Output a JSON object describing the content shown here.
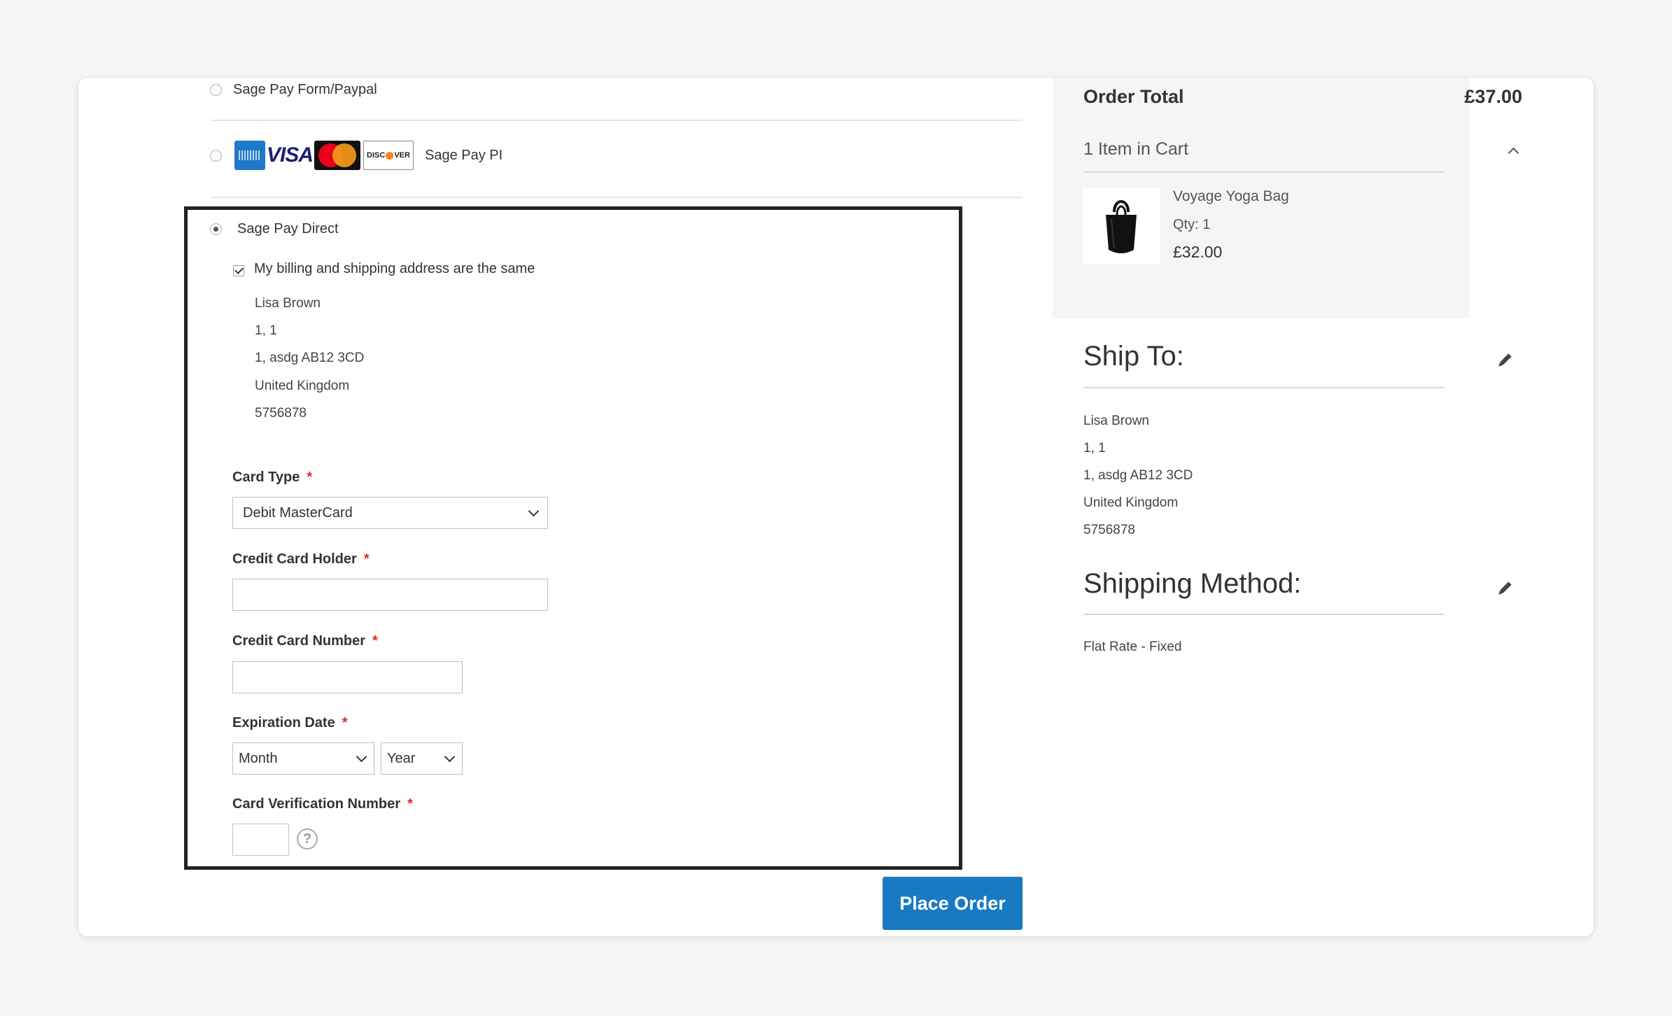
{
  "payment_methods": {
    "form_paypal": {
      "label": "Sage Pay Form/Paypal"
    },
    "pi": {
      "label": "Sage Pay PI",
      "card_logos": [
        "amex-icon",
        "visa-icon",
        "mastercard-icon",
        "discover-icon"
      ],
      "visa_text": "VISA",
      "discover_text": "DISC VER"
    },
    "direct": {
      "label": "Sage Pay Direct",
      "same_address_label": "My billing and shipping address are the same",
      "address": {
        "name": "Lisa Brown",
        "line1": "1, 1",
        "line2": "1, asdg AB12 3CD",
        "country": "United Kingdom",
        "phone": "5756878"
      },
      "fields": {
        "card_type": {
          "label": "Card Type",
          "value": "Debit MasterCard"
        },
        "holder": {
          "label": "Credit Card Holder",
          "value": ""
        },
        "number": {
          "label": "Credit Card Number",
          "value": ""
        },
        "expiration": {
          "label": "Expiration Date",
          "month": "Month",
          "year": "Year"
        },
        "cvv": {
          "label": "Card Verification Number",
          "value": "",
          "help": "?"
        }
      },
      "required_mark": "*"
    }
  },
  "actions": {
    "place_order": "Place Order"
  },
  "summary": {
    "order_total_label": "Order Total",
    "order_total_value": "£37.00",
    "items_in_cart": "1 Item in Cart",
    "item": {
      "name": "Voyage Yoga Bag",
      "qty": "Qty: 1",
      "price": "£32.00"
    }
  },
  "ship_to": {
    "title": "Ship To:",
    "name": "Lisa Brown",
    "line1": "1, 1",
    "line2": "1, asdg AB12 3CD",
    "country": "United Kingdom",
    "phone": "5756878"
  },
  "shipping_method": {
    "title": "Shipping Method:",
    "value": "Flat Rate - Fixed"
  },
  "colors": {
    "accent": "#1979c3",
    "required": "#e02b27",
    "highlight_border": "#222222"
  }
}
